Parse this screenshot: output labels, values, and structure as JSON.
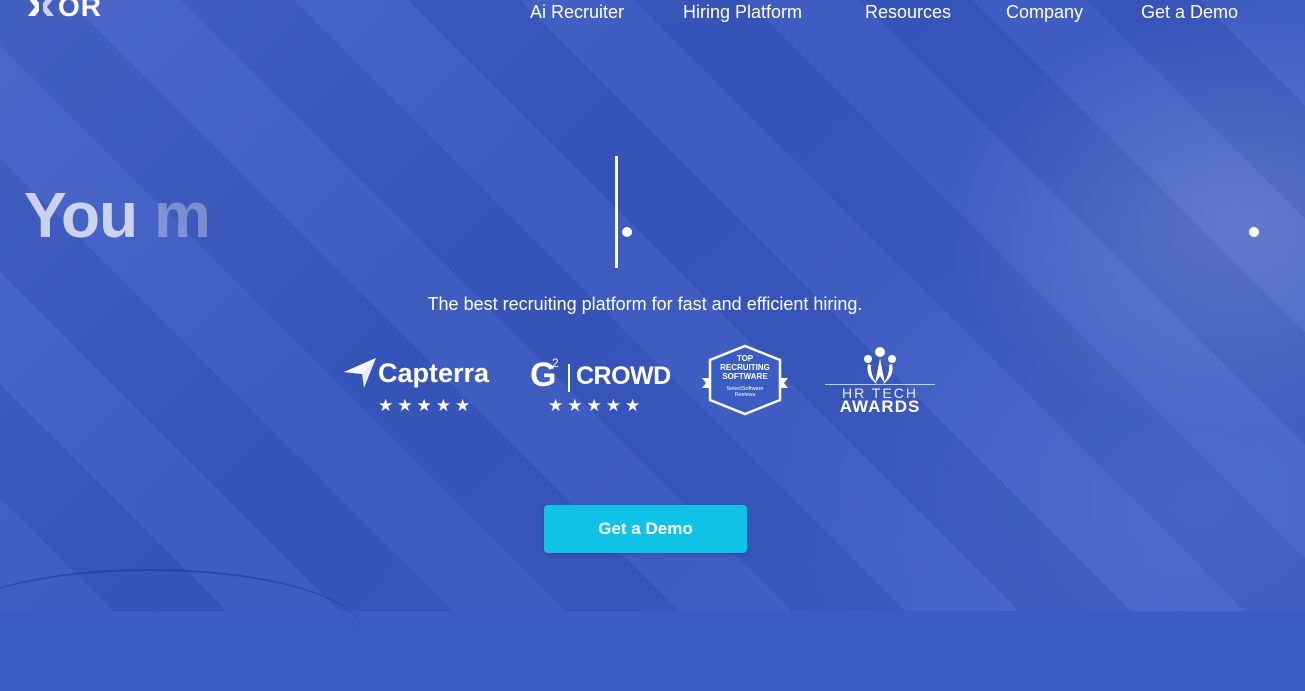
{
  "brand": {
    "logo_text": "OR"
  },
  "nav": {
    "items": [
      {
        "label": "Ai Recruiter"
      },
      {
        "label": "Hiring Platform"
      },
      {
        "label": "Resources"
      },
      {
        "label": "Company"
      },
      {
        "label": "Get a Demo"
      }
    ]
  },
  "hero": {
    "headline_typed": "You ",
    "headline_typed_fading": "m",
    "subtitle": "The best recruiting platform for fast and efficient hiring.",
    "cta_label": "Get a Demo"
  },
  "badges": {
    "capterra": {
      "name": "Capterra",
      "stars": "★★★★★"
    },
    "g2": {
      "superscript": "2",
      "name": "CROWD",
      "stars": "★★★★★"
    },
    "selectsoftware": {
      "line1": "TOP",
      "line2": "RECRUITING",
      "line3": "SOFTWARE",
      "line4": "SelectSoftware",
      "line5": "Reviews"
    },
    "hrtech": {
      "line1": "HR TECH",
      "line2": "AWARDS"
    }
  },
  "colors": {
    "background": "#3a5cc4",
    "cta": "#10c3e6"
  }
}
